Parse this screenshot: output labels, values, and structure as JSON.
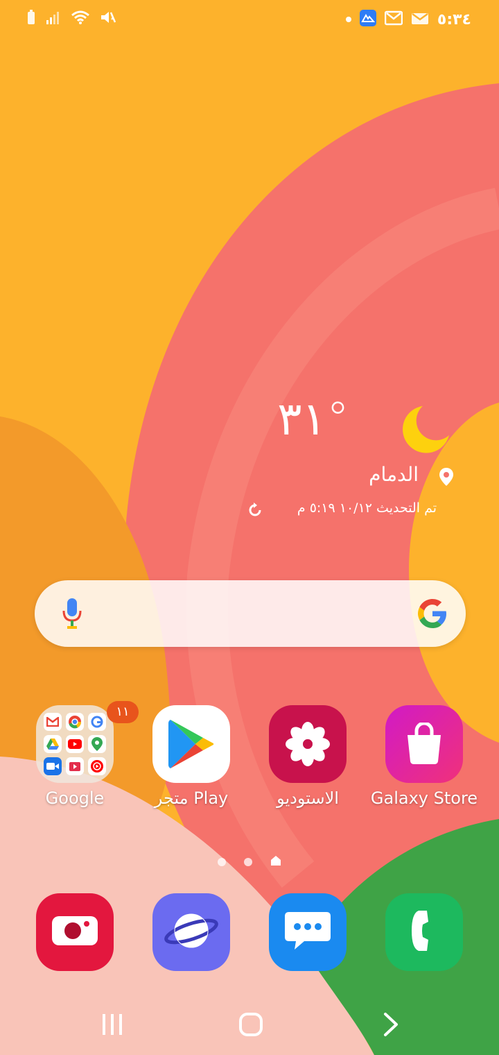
{
  "status_bar": {
    "time": "٥:٣٤",
    "left_icons": [
      "battery-icon",
      "signal-icon",
      "wifi-icon",
      "mute-icon"
    ],
    "right_icons": [
      "notification-dot",
      "app-notification-icon",
      "gallery-icon",
      "email-icon"
    ]
  },
  "weather": {
    "temperature": "٣١°",
    "condition_icon": "moon-icon",
    "city": "الدمام",
    "updated": "تم التحديث ١٠/١٢ ٥:١٩ م"
  },
  "search": {
    "mic_icon": "mic-icon",
    "logo_icon": "google-g-icon"
  },
  "apps": [
    {
      "label": "Google",
      "icon": "google-folder-icon",
      "badge": "١١"
    },
    {
      "label": "متجر Play",
      "icon": "play-store-icon"
    },
    {
      "label": "الاستوديو",
      "icon": "gallery-flower-icon"
    },
    {
      "label": "Galaxy Store",
      "icon": "galaxy-store-bag-icon"
    }
  ],
  "page_indicator": {
    "pages": 3,
    "current": "home"
  },
  "dock": [
    {
      "name": "camera",
      "icon": "camera-icon",
      "color": "#E3173E"
    },
    {
      "name": "internet",
      "icon": "internet-planet-icon",
      "color": "#6B6BF0"
    },
    {
      "name": "messages",
      "icon": "messages-icon",
      "color": "#1A8AF0"
    },
    {
      "name": "phone",
      "icon": "phone-icon",
      "color": "#1DB95E"
    }
  ],
  "nav": {
    "recents_icon": "recents-icon",
    "home_icon": "home-icon",
    "back_icon": "back-icon"
  },
  "colors": {
    "wallpaper_orange": "#FDB22C",
    "wallpaper_pink": "#F66A6A",
    "wallpaper_green": "#43A647"
  }
}
